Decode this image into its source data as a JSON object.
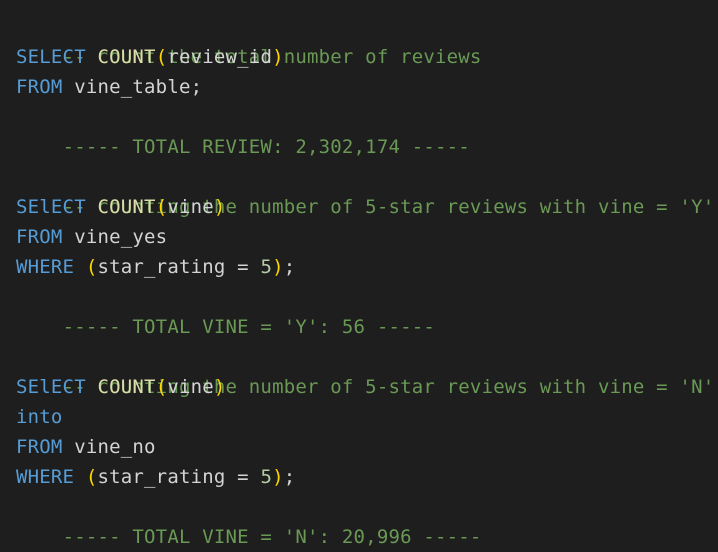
{
  "colors": {
    "background": "#1e1e1e",
    "comment": "#6a9955",
    "keyword": "#569cd6",
    "function": "#dcdcaa",
    "bracket": "#ffd700",
    "text": "#d4d4d4",
    "number": "#b5cea8"
  },
  "code": {
    "block1": {
      "comment": "-- count the total number of reviews",
      "select_kw": "SELECT",
      "func": "COUNT",
      "open_paren": "(",
      "arg": "review_id",
      "close_paren": ")",
      "from_kw": "FROM",
      "table": " vine_table;",
      "result": "----- TOTAL REVIEW: 2,302,174 -----"
    },
    "block2": {
      "comment": "-- counting the number of 5-star reviews with vine = 'Y'",
      "select_kw": "SElECT",
      "func": "COUNT",
      "open_paren": "(",
      "arg": "vine",
      "close_paren": ")",
      "from_kw": "FROM",
      "table": " vine_yes",
      "where_kw": "WHERE",
      "cond_open": "(",
      "cond_text": "star_rating = ",
      "cond_num": "5",
      "cond_close": ")",
      "cond_end": ";",
      "result": "----- TOTAL VINE = 'Y': 56 -----"
    },
    "block3": {
      "comment": "-- counting the number of 5-star reviews with vine = 'N'",
      "select_kw": "SElECT",
      "func": "COUNT",
      "open_paren": "(",
      "arg": "vine",
      "close_paren": ")",
      "into_kw": "into",
      "from_kw": "FROM",
      "table": " vine_no",
      "where_kw": "WHERE",
      "cond_open": "(",
      "cond_text": "star_rating = ",
      "cond_num": "5",
      "cond_close": ")",
      "cond_end": ";",
      "result": "----- TOTAL VINE = 'N': 20,996 -----"
    }
  }
}
